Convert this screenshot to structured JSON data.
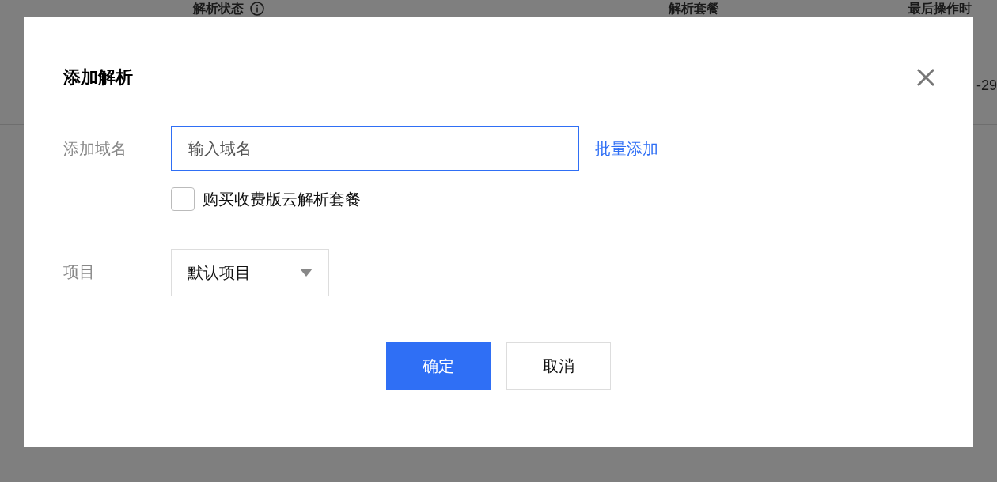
{
  "background_table": {
    "columns": [
      {
        "label": "解析状态",
        "info_icon": true
      },
      {
        "label": "解析套餐",
        "info_icon": false
      },
      {
        "label": "最后操作时",
        "info_icon": false
      }
    ],
    "row_fragment": "-29"
  },
  "dialog": {
    "title": "添加解析",
    "domain_field": {
      "label": "添加域名",
      "placeholder": "输入域名",
      "focused": true,
      "link": "批量添加"
    },
    "paid_plan_checkbox": {
      "label": "购买收费版云解析套餐",
      "checked": false
    },
    "project_field": {
      "label": "项目",
      "value": "默认项目"
    },
    "buttons": [
      {
        "label": "确定",
        "kind": "primary"
      },
      {
        "label": "取消",
        "kind": "default"
      }
    ]
  }
}
